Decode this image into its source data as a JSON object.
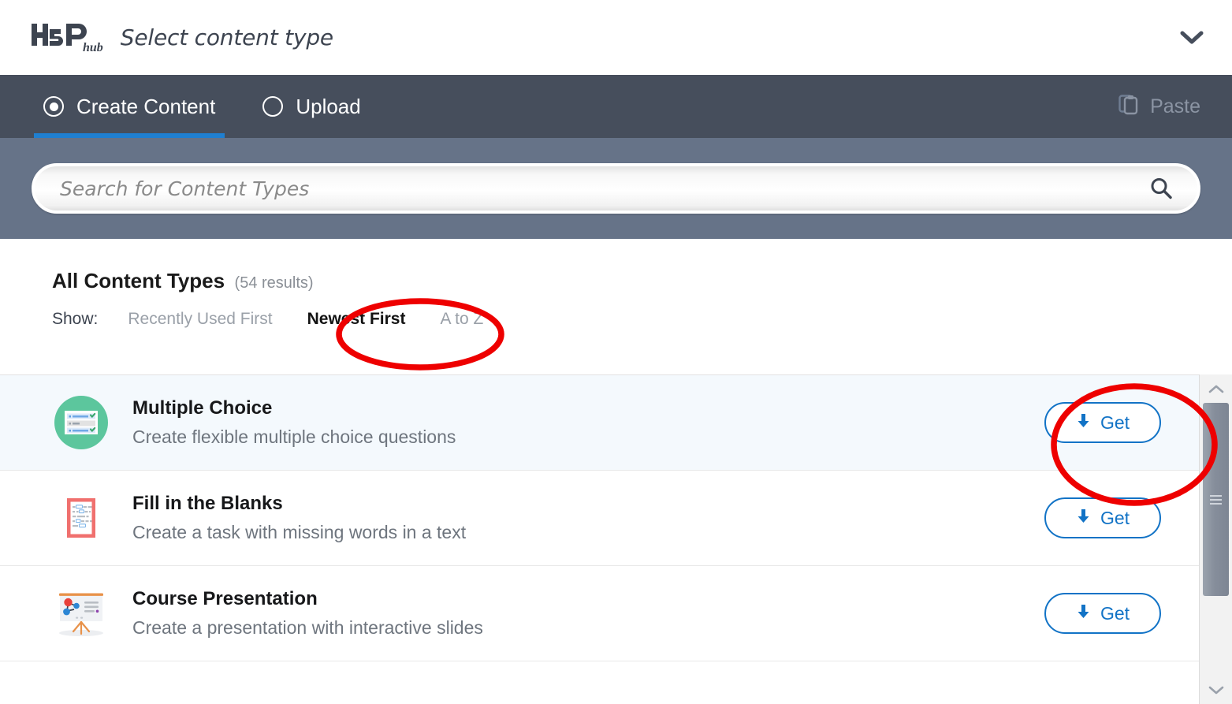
{
  "window": {
    "logo_text": "H5P",
    "logo_subscript": "hub",
    "title": "Select content type",
    "collapse_icon": "chevron-down-icon"
  },
  "tabs": {
    "create": {
      "label": "Create Content",
      "selected": true
    },
    "upload": {
      "label": "Upload",
      "selected": false
    },
    "paste": {
      "label": "Paste",
      "icon": "clipboard-icon",
      "disabled": true
    }
  },
  "search": {
    "placeholder": "Search for Content Types",
    "value": "",
    "icon": "search-icon"
  },
  "results": {
    "heading": "All Content Types",
    "count_label": "(54 results)",
    "show_label": "Show:",
    "sort_options": [
      {
        "label": "Recently Used First",
        "active": false
      },
      {
        "label": "Newest First",
        "active": true
      },
      {
        "label": "A to Z",
        "active": false
      }
    ]
  },
  "content_types": [
    {
      "title": "Multiple Choice",
      "description": "Create flexible multiple choice questions",
      "icon": "multiple-choice-icon",
      "button_label": "Get",
      "button_icon": "download-arrow-icon",
      "highlighted": true
    },
    {
      "title": "Fill in the Blanks",
      "description": "Create a task with missing words in a text",
      "icon": "fill-in-the-blanks-icon",
      "button_label": "Get",
      "button_icon": "download-arrow-icon",
      "highlighted": false
    },
    {
      "title": "Course Presentation",
      "description": "Create a presentation with interactive slides",
      "icon": "course-presentation-icon",
      "button_label": "Get",
      "button_icon": "download-arrow-icon",
      "highlighted": false
    }
  ],
  "scrollbar": {
    "up_icon": "chevron-up-icon",
    "down_icon": "chevron-down-icon"
  },
  "annotations": [
    {
      "target": "Newest First",
      "shape": "ellipse",
      "color": "#ee0000"
    },
    {
      "target": "Get",
      "shape": "ellipse",
      "color": "#ee0000"
    }
  ],
  "colors": {
    "tabbar_bg": "#464e5c",
    "searchpanel_bg": "#667388",
    "accent_blue": "#1f7fd0",
    "link_blue": "#1273c6",
    "annotation_red": "#ee0000",
    "row_highlight": "#f4f9fd"
  }
}
